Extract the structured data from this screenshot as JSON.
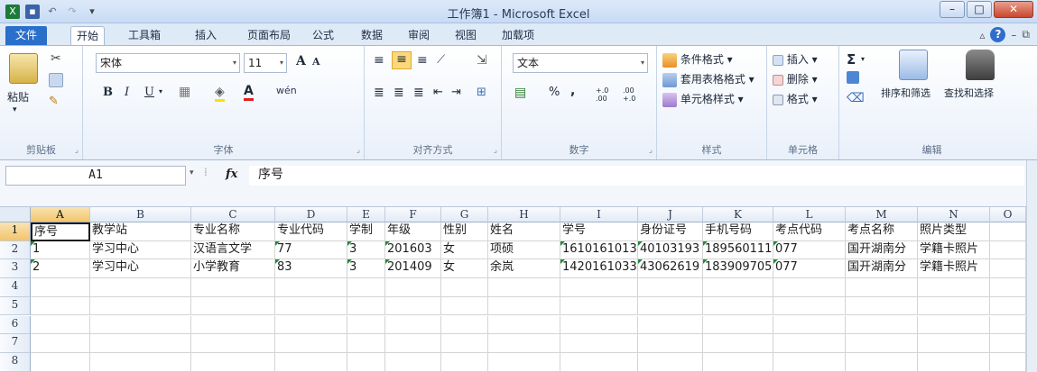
{
  "window": {
    "title": "工作簿1 - Microsoft Excel",
    "minimize": "–",
    "maximize": "□",
    "close": "✕"
  },
  "tabs": [
    {
      "label": "文件"
    },
    {
      "label": "开始"
    },
    {
      "label": "工具箱"
    },
    {
      "label": "插入"
    },
    {
      "label": "页面布局"
    },
    {
      "label": "公式"
    },
    {
      "label": "数据"
    },
    {
      "label": "审阅"
    },
    {
      "label": "视图"
    },
    {
      "label": "加载项"
    }
  ],
  "ribbon": {
    "clipboard": {
      "paste": "粘贴",
      "group": "剪贴板"
    },
    "font": {
      "name": "宋体",
      "size": "11",
      "bold": "B",
      "italic": "I",
      "underline": "U",
      "grow": "A",
      "shrink": "A",
      "phonetic": "wén",
      "group": "字体"
    },
    "alignment": {
      "group": "对齐方式"
    },
    "number": {
      "format": "文本",
      "percent": "%",
      "comma": ",",
      "inc": "+.0 .00",
      "dec": ".00 +.0",
      "group": "数字"
    },
    "styles": {
      "conditional": "条件格式",
      "table": "套用表格格式",
      "cell": "单元格样式",
      "group": "样式"
    },
    "cells": {
      "insert": "插入",
      "delete": "删除",
      "format": "格式",
      "group": "单元格"
    },
    "editing": {
      "sigma": "Σ",
      "sort": "排序和筛选",
      "find": "查找和选择",
      "group": "编辑"
    }
  },
  "formula_bar": {
    "name_box": "A1",
    "fx": "fx",
    "value": "序号"
  },
  "columns": [
    "A",
    "B",
    "C",
    "D",
    "E",
    "F",
    "G",
    "H",
    "I",
    "J",
    "K",
    "L",
    "M",
    "N",
    "O"
  ],
  "rows": [
    "1",
    "2",
    "3",
    "4",
    "5",
    "6",
    "7",
    "8"
  ],
  "cells": [
    [
      "序号",
      "教学站",
      "专业名称",
      "专业代码",
      "学制",
      "年级",
      "性别",
      "姓名",
      "学号",
      "身份证号",
      "手机号码",
      "考点代码",
      "考点名称",
      "照片类型"
    ],
    [
      "1",
      "学习中心",
      "汉语言文学",
      "77",
      "3",
      "201603",
      "女",
      "项硕",
      "1610161013",
      "40103193",
      "189560111",
      "077",
      "国开湖南分",
      "学籍卡照片"
    ],
    [
      "2",
      "学习中心",
      "小学教育",
      "83",
      "3",
      "201409",
      "女",
      "余岚",
      "1420161033",
      "43062619",
      "183909705",
      "077",
      "国开湖南分",
      "学籍卡照片"
    ]
  ],
  "colors": {
    "file_tab": "#2a6fc9",
    "selected_header": "#f2c56b",
    "error_flag": "#1e8b3a"
  }
}
